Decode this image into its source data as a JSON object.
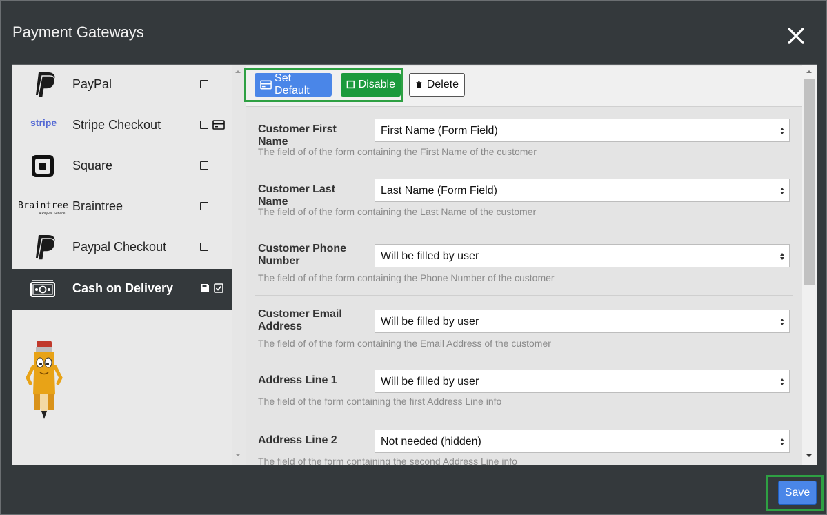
{
  "dialog": {
    "title": "Payment Gateways",
    "save_label": "Save"
  },
  "sidebar": {
    "items": [
      {
        "label": "PayPal",
        "logo": "paypal-logo"
      },
      {
        "label": "Stripe Checkout",
        "logo_text": "stripe"
      },
      {
        "label": "Square",
        "logo": "square-logo"
      },
      {
        "label": "Braintree",
        "logo_text": "Braintree",
        "logo_subtext": "A PayPal Service"
      },
      {
        "label": "Paypal Checkout",
        "logo": "paypal-logo"
      },
      {
        "label": "Cash on Delivery",
        "logo": "cash-icon",
        "active": true
      }
    ]
  },
  "toolbar": {
    "set_default_label": "Set Default",
    "disable_label": "Disable",
    "delete_label": "Delete"
  },
  "fields": [
    {
      "label": "Customer First Name",
      "value": "First Name (Form Field)",
      "help": "The field of of the form containing the First Name of the customer"
    },
    {
      "label": "Customer Last Name",
      "value": "Last Name (Form Field)",
      "help": "The field of of the form containing the Last Name of the customer"
    },
    {
      "label": "Customer Phone Number",
      "value": "Will be filled by user",
      "help": "The field of of the form containing the Phone Number of the customer"
    },
    {
      "label": "Customer Email Address",
      "value": "Will be filled by user",
      "help": "The field of of the form containing the Email Address of the customer"
    },
    {
      "label": "Address Line 1",
      "value": "Will be filled by user",
      "help": "The field of the form containing the first Address Line info"
    },
    {
      "label": "Address Line 2",
      "value": "Not needed (hidden)",
      "help": "The field of the form containing the second Address Line info"
    }
  ],
  "colors": {
    "primary": "#4a86e8",
    "success": "#1a9a3c",
    "highlight": "#2ea043",
    "dark": "#34393c"
  }
}
